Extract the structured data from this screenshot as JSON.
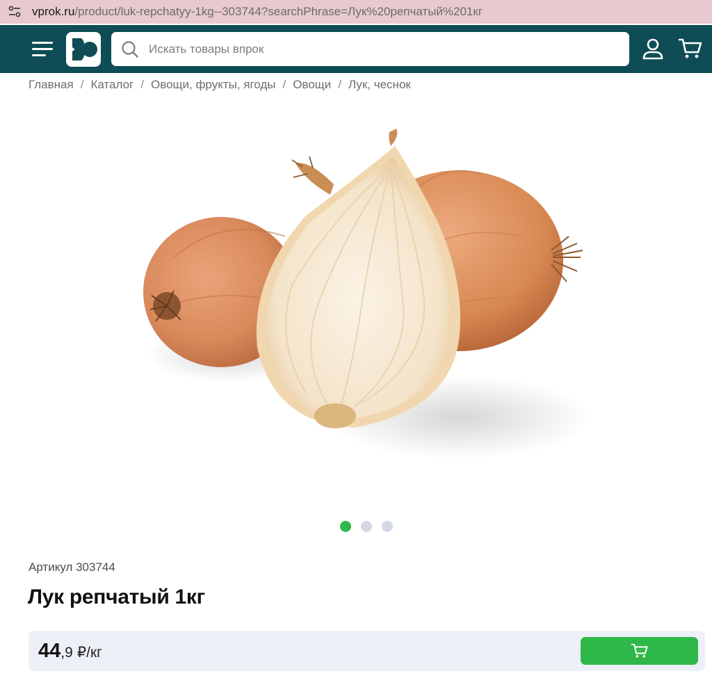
{
  "browser": {
    "url_host": "vprok.ru",
    "url_path": "/product/luk-repchatyy-1kg--303744?searchPhrase=Лук%20репчатый%201кг",
    "site_settings_icon": "tune-icon"
  },
  "header": {
    "menu_icon": "hamburger-menu-icon",
    "logo_icon": "vprok-logo-icon",
    "search": {
      "placeholder": "Искать товары впрок",
      "value": "",
      "icon": "search-icon"
    },
    "user_icon": "user-icon",
    "cart_icon": "cart-icon"
  },
  "breadcrumb": {
    "items": [
      "Главная",
      "Каталог",
      "Овощи, фрукты, ягоды",
      "Овощи",
      "Лук, чеснок"
    ],
    "separator": "/"
  },
  "gallery": {
    "image_subject": "onion",
    "dots_total": 3,
    "active_dot": 1
  },
  "product": {
    "article": "Артикул 303744",
    "title": "Лук репчатый 1кг"
  },
  "price": {
    "integer": "44",
    "fraction": ",9",
    "unit": "₽/кг",
    "add_to_cart_icon": "cart-icon"
  },
  "colors": {
    "header_bg": "#0e4d55",
    "accent_green": "#2fb84a",
    "address_bar_bg": "#e7c9cf",
    "price_bar_bg": "#edf0f6"
  }
}
